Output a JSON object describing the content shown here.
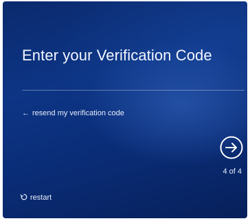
{
  "screen": {
    "title": "Enter your Verification Code",
    "resend_arrow": "←",
    "resend_label": "resend my verification code",
    "next_icon": "arrow-right-circle-icon",
    "step_indicator": "4 of 4",
    "restart_icon": "restart-icon",
    "restart_label": "restart"
  },
  "colors": {
    "background": "#0b2a6e",
    "text": "#ffffff"
  }
}
